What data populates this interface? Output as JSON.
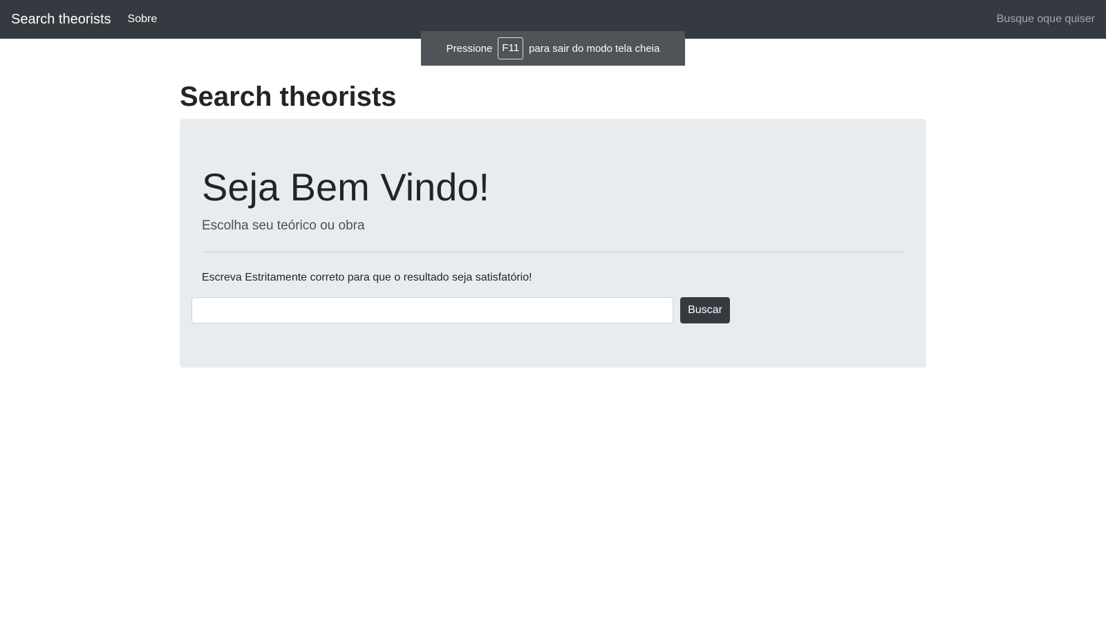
{
  "navbar": {
    "brand": "Search theorists",
    "link_about": "Sobre",
    "right_link": "Busque oque quiser"
  },
  "fullscreen_toast": {
    "before": "Pressione",
    "key": "F11",
    "after": "para sair do modo tela cheia"
  },
  "page": {
    "title": "Search theorists"
  },
  "jumbotron": {
    "heading": "Seja Bem Vindo!",
    "lead": "Escolha seu teórico ou obra",
    "hint": "Escreva Estritamente correto para que o resultado seja satisfatório!",
    "search_value": "",
    "search_placeholder": "",
    "button_label": "Buscar"
  },
  "colors": {
    "navbar_bg": "#343a40",
    "jumbotron_bg": "#e9ecef",
    "button_bg": "#343a40"
  }
}
